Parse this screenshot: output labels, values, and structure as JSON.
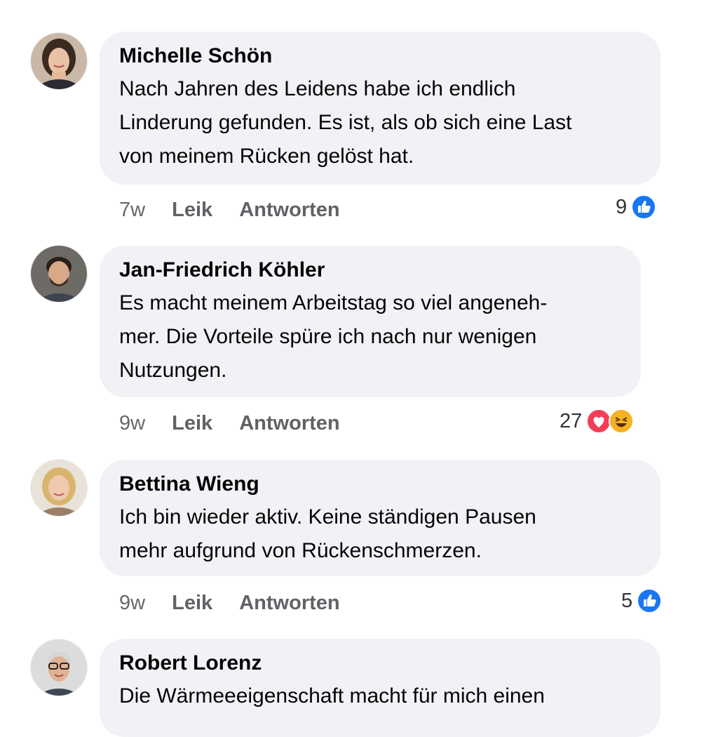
{
  "comments": [
    {
      "author": "Michelle Schön",
      "text": "Nach Jahren des Leidens habe ich endlich\nLinderung gefunden. Es ist, als ob sich eine Last\nvon meinem Rücken gelöst hat.",
      "time": "7w",
      "like_label": "Leik",
      "reply_label": "Antworten",
      "reaction_count": "9",
      "reactions": [
        "like-icon"
      ]
    },
    {
      "author": "Jan-Friedrich Köhler",
      "text": "Es macht meinem Arbeitstag so viel angeneh-\nmer. Die Vorteile spüre ich nach nur wenigen\nNutzungen.",
      "time": "9w",
      "like_label": "Leik",
      "reply_label": "Antworten",
      "reaction_count": "27",
      "reactions": [
        "love-icon",
        "haha-icon"
      ]
    },
    {
      "author": "Bettina Wieng",
      "text": "Ich bin wieder aktiv. Keine ständigen Pausen\nmehr aufgrund von Rückenschmerzen.",
      "time": "9w",
      "like_label": "Leik",
      "reply_label": "Antworten",
      "reaction_count": "5",
      "reactions": [
        "like-icon"
      ]
    },
    {
      "author": "Robert Lorenz",
      "text": "Die Wärmeeeigenschaft macht für mich einen"
    }
  ],
  "colors": {
    "bubble": "#f0f2f5",
    "like_blue": "#1877f2",
    "love_red": "#f33e58",
    "haha_yellow": "#f7b125",
    "meta_gray": "#65676b"
  }
}
